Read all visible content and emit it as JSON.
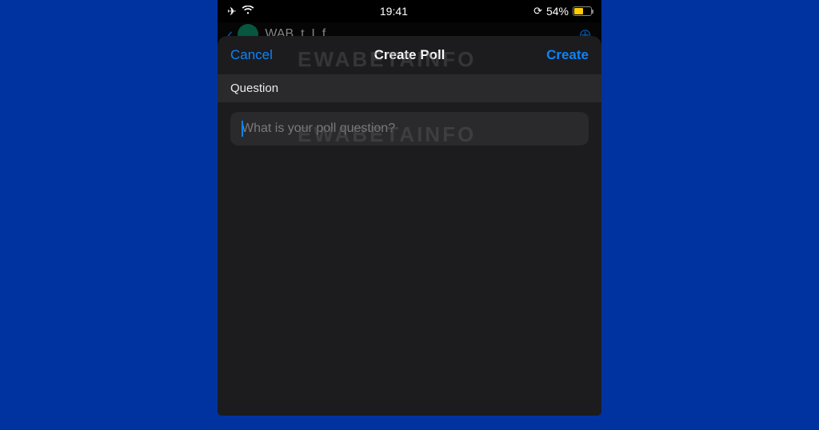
{
  "status_bar": {
    "time": "19:41",
    "battery_percent": "54%",
    "battery_fill_pct": 54
  },
  "behind_screen": {
    "chat_title": "WAB..t..I..f.."
  },
  "modal": {
    "cancel_label": "Cancel",
    "title": "Create Poll",
    "create_label": "Create",
    "section_header": "Question",
    "input_placeholder": "What is your poll question?",
    "input_value": ""
  },
  "watermark": {
    "text": "EWABETAINFO"
  },
  "colors": {
    "background": "#0033a0",
    "modal_bg": "#1c1c1e",
    "accent": "#0a84ff",
    "battery_fill": "#ffcc00"
  }
}
